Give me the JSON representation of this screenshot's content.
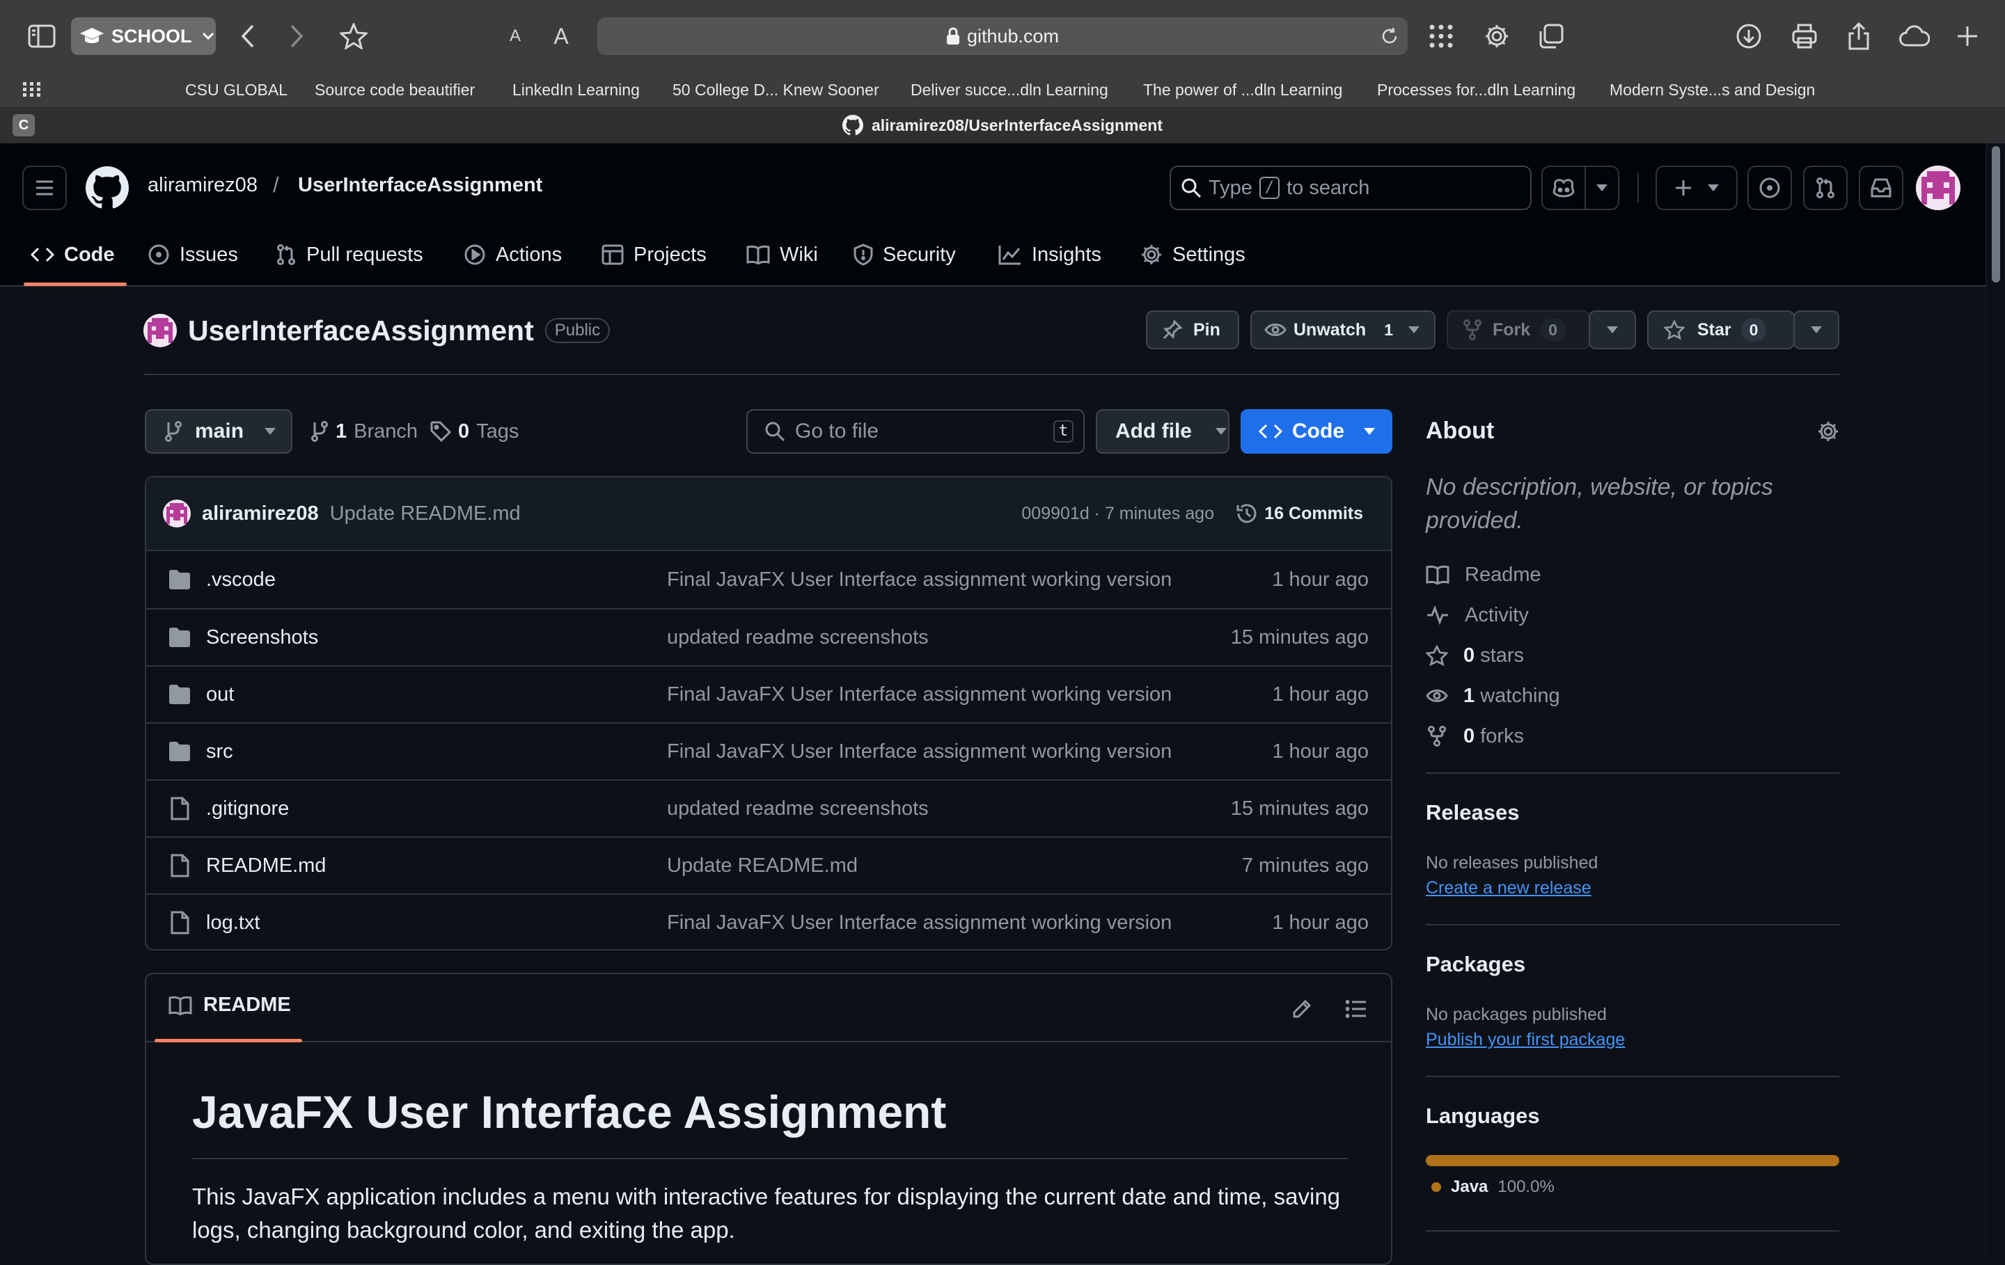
{
  "safari": {
    "profile_label": "SCHOOL",
    "font_small": "A",
    "font_large": "A",
    "address": "github.com",
    "tab_title": "aliramirez08/UserInterfaceAssignment",
    "tab_favicon_letter": "C",
    "bookmarks": [
      "CSU GLOBAL",
      "Source code beautifier",
      "LinkedIn Learning",
      "50 College D... Knew Sooner",
      "Deliver succe...dln Learning",
      "The power of ...dln Learning",
      "Processes for...dln Learning",
      "Modern Syste...s and Design"
    ]
  },
  "header": {
    "owner": "aliramirez08",
    "separator": "/",
    "repo": "UserInterfaceAssignment",
    "search_prefix": "Type",
    "search_key": "/",
    "search_suffix": "to search"
  },
  "nav_tabs": [
    {
      "label": "Code",
      "icon": "code-icon"
    },
    {
      "label": "Issues",
      "icon": "issue-opened-icon"
    },
    {
      "label": "Pull requests",
      "icon": "git-pull-request-icon"
    },
    {
      "label": "Actions",
      "icon": "play-icon"
    },
    {
      "label": "Projects",
      "icon": "table-icon"
    },
    {
      "label": "Wiki",
      "icon": "book-icon"
    },
    {
      "label": "Security",
      "icon": "shield-icon"
    },
    {
      "label": "Insights",
      "icon": "graph-icon"
    },
    {
      "label": "Settings",
      "icon": "gear-icon"
    }
  ],
  "repo_header": {
    "title": "UserInterfaceAssignment",
    "visibility": "Public",
    "pin_label": "Pin",
    "watch_label": "Unwatch",
    "watch_count": "1",
    "fork_label": "Fork",
    "fork_count": "0",
    "star_label": "Star",
    "star_count": "0"
  },
  "file_nav": {
    "branch": "main",
    "branch_count": "1",
    "branch_label": "Branch",
    "tag_count": "0",
    "tag_label": "Tags",
    "goto_placeholder": "Go to file",
    "goto_key": "t",
    "add_file_label": "Add file",
    "code_label": "Code"
  },
  "latest_commit": {
    "author": "aliramirez08",
    "message": "Update README.md",
    "meta": "009901d · 7 minutes ago",
    "commits_label": "16 Commits"
  },
  "files": [
    {
      "type": "folder",
      "name": ".vscode",
      "message": "Final JavaFX User Interface assignment working version",
      "date": "1 hour ago"
    },
    {
      "type": "folder",
      "name": "Screenshots",
      "message": "updated readme screenshots",
      "date": "15 minutes ago"
    },
    {
      "type": "folder",
      "name": "out",
      "message": "Final JavaFX User Interface assignment working version",
      "date": "1 hour ago"
    },
    {
      "type": "folder",
      "name": "src",
      "message": "Final JavaFX User Interface assignment working version",
      "date": "1 hour ago"
    },
    {
      "type": "file",
      "name": ".gitignore",
      "message": "updated readme screenshots",
      "date": "15 minutes ago"
    },
    {
      "type": "file",
      "name": "README.md",
      "message": "Update README.md",
      "date": "7 minutes ago"
    },
    {
      "type": "file",
      "name": "log.txt",
      "message": "Final JavaFX User Interface assignment working version",
      "date": "1 hour ago"
    }
  ],
  "readme": {
    "tab_label": "README",
    "heading": "JavaFX User Interface Assignment",
    "paragraph": "This JavaFX application includes a menu with interactive features for displaying the current date and time, saving logs, changing background color, and exiting the app."
  },
  "sidebar": {
    "about_title": "About",
    "about_desc": "No description, website, or topics provided.",
    "readme_label": "Readme",
    "activity_label": "Activity",
    "stars_count": "0",
    "stars_label": "stars",
    "watching_count": "1",
    "watching_label": "watching",
    "forks_count": "0",
    "forks_label": "forks",
    "releases_title": "Releases",
    "releases_none": "No releases published",
    "releases_link": "Create a new release",
    "packages_title": "Packages",
    "packages_none": "No packages published",
    "packages_link": "Publish your first package",
    "languages_title": "Languages",
    "languages": [
      {
        "name": "Java",
        "percent": "100.0%",
        "fraction": 1.0,
        "color": "#b07219"
      }
    ]
  },
  "colors": {
    "bg": "#0d1117",
    "header_bg": "#010409",
    "accent_blue": "#1f6feb",
    "link_blue": "#4493f8",
    "tab_underline": "#f78166",
    "java": "#b07219"
  }
}
